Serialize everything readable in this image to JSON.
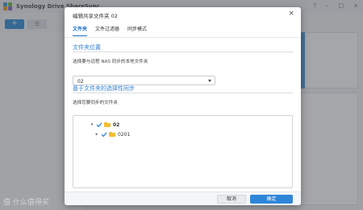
{
  "background": {
    "app_title": "Synology Drive ShareSync",
    "add_label": "+",
    "list_label": "☰",
    "window_buttons": [
      "?",
      "–",
      "□",
      "×"
    ],
    "watermark": "值 什么值得买"
  },
  "dialog": {
    "title": "编辑共享文件夹 02",
    "close_label": "×",
    "tabs": [
      {
        "label": "文件夹",
        "active": true
      },
      {
        "label": "文件过滤器",
        "active": false
      },
      {
        "label": "同步模式",
        "active": false
      }
    ],
    "location_section": {
      "title": "文件夹位置",
      "label": "选择要与远程 NAS 同步的本地文件夹",
      "selected_value": "02"
    },
    "selective_section": {
      "title": "基于文件夹的选择性同步",
      "label": "选择您要同步的文件夹"
    },
    "tree": [
      {
        "label": "02",
        "expanded": true,
        "checked": true,
        "level": 0
      },
      {
        "label": "0201",
        "expanded": false,
        "checked": true,
        "level": 1
      }
    ],
    "footer": {
      "cancel_label": "取消",
      "ok_label": "确定"
    }
  },
  "colors": {
    "accent": "#2f86d8",
    "section_title": "#2e7fd0",
    "folder": "#f5bd30",
    "check": "#2f86d8"
  }
}
